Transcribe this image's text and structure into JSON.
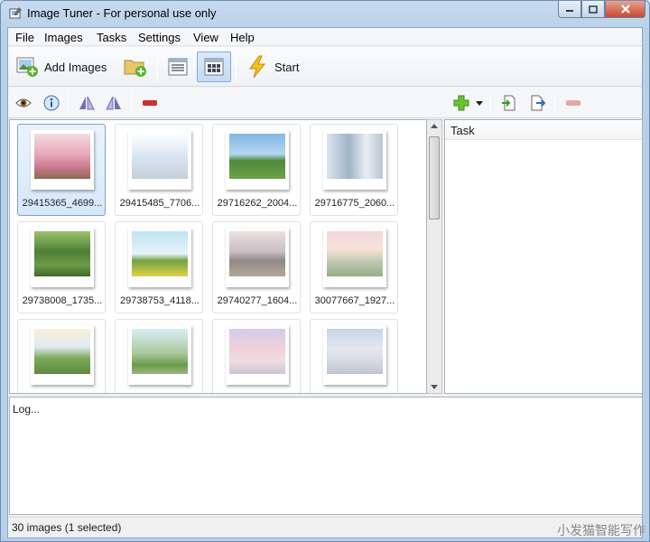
{
  "window": {
    "title": "Image Tuner - For personal use only"
  },
  "menu": [
    "File",
    "Images",
    "Tasks",
    "Settings",
    "View",
    "Help"
  ],
  "toolbar": {
    "add_images": "Add Images",
    "start": "Start"
  },
  "task_panel": {
    "header": "Task"
  },
  "thumbnails": [
    {
      "label": "29415365_4699...",
      "selected": true
    },
    {
      "label": "29415485_7706...",
      "selected": false
    },
    {
      "label": "29716262_2004...",
      "selected": false
    },
    {
      "label": "29716775_2060...",
      "selected": false
    },
    {
      "label": "29738008_1735...",
      "selected": false
    },
    {
      "label": "29738753_4118...",
      "selected": false
    },
    {
      "label": "29740277_1604...",
      "selected": false
    },
    {
      "label": "30077667_1927...",
      "selected": false
    },
    {
      "label": "",
      "selected": false
    },
    {
      "label": "",
      "selected": false
    },
    {
      "label": "",
      "selected": false
    },
    {
      "label": "",
      "selected": false
    }
  ],
  "log": {
    "text": "Log..."
  },
  "status": {
    "text": "30 images (1 selected)"
  },
  "watermark": "小发猫智能写作",
  "colors": {
    "accent": "#84a9d6",
    "add_green": "#5db12f",
    "remove_red": "#c9302c"
  }
}
